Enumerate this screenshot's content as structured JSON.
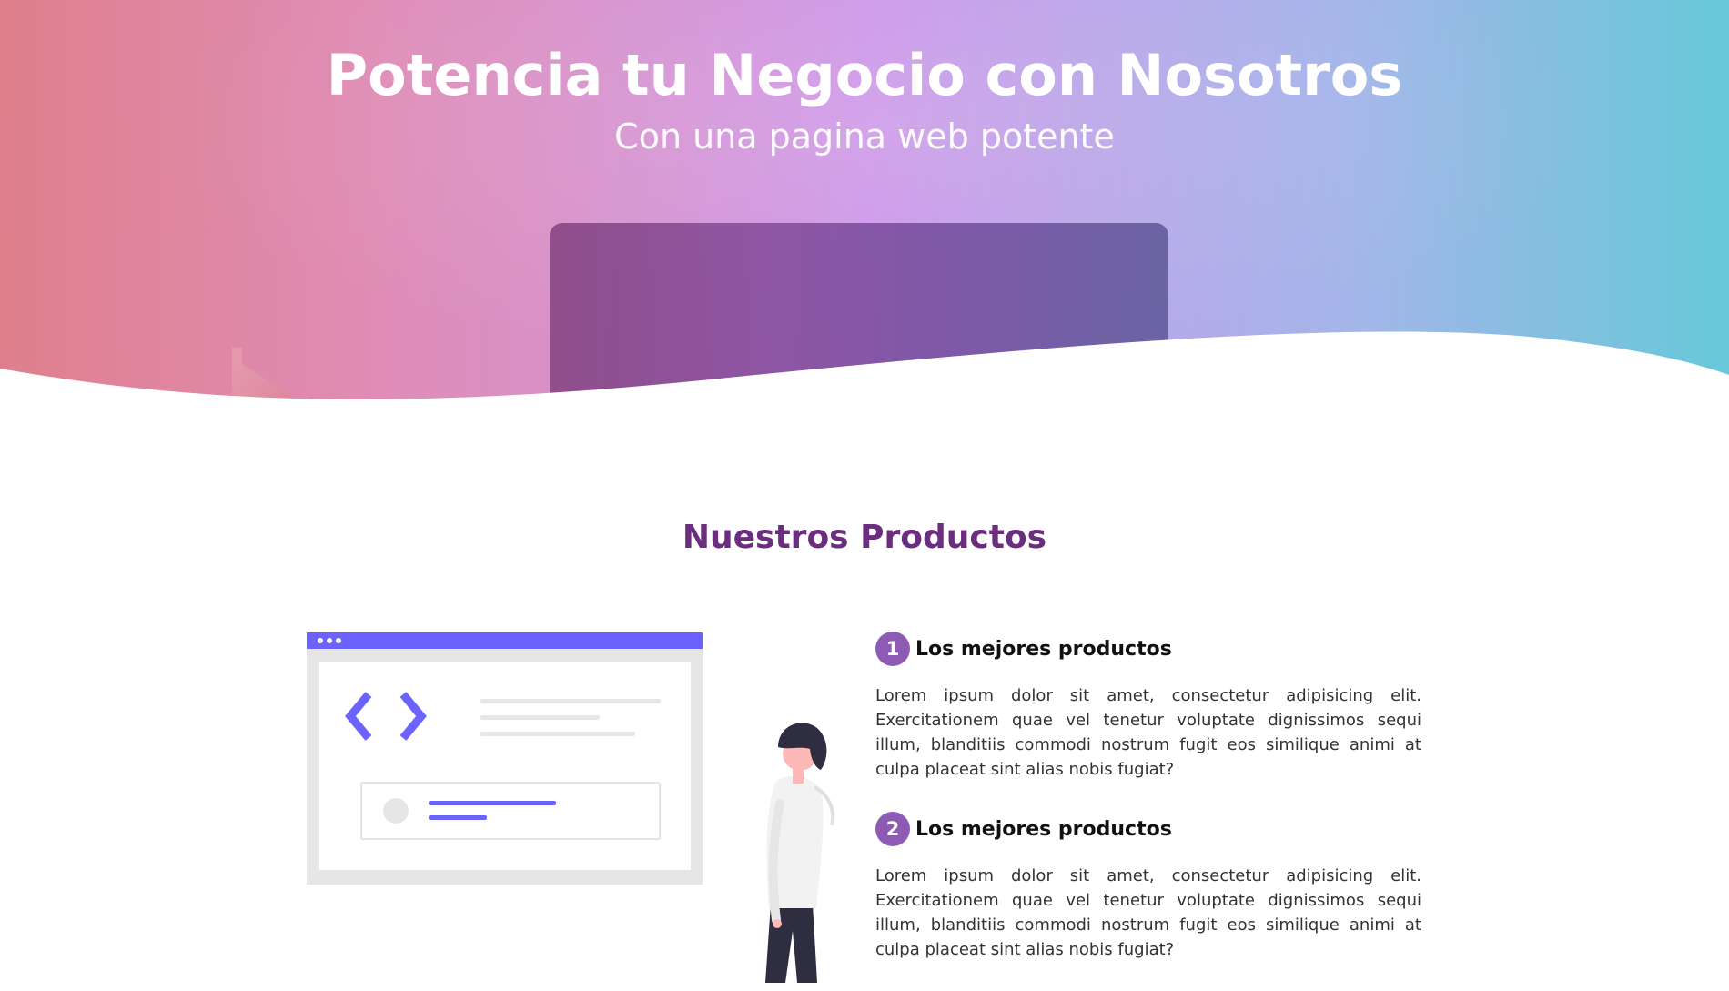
{
  "hero": {
    "title": "Potencia tu Negocio con Nosotros",
    "subtitle": "Con una pagina web potente"
  },
  "products_section": {
    "title": "Nuestros Productos",
    "items": [
      {
        "number": "1",
        "title": "Los mejores productos",
        "text": "Lorem ipsum dolor sit amet, consectetur adipisicing elit. Exercitationem quae vel tenetur voluptate dignissimos sequi illum, blanditiis commodi nostrum fugit eos similique animi at culpa placeat sint alias nobis fugiat?"
      },
      {
        "number": "2",
        "title": "Los mejores productos",
        "text": "Lorem ipsum dolor sit amet, consectetur adipisicing elit. Exercitationem quae vel tenetur voluptate dignissimos sequi illum, blanditiis commodi nostrum fugit eos similique animi at culpa placeat sint alias nobis fugiat?"
      }
    ]
  },
  "colors": {
    "title_purple": "#6b2d7d",
    "badge_purple": "#8e5bb4",
    "illustration_accent": "#6c63ff"
  },
  "icons": {
    "code": "code-brackets-icon"
  }
}
